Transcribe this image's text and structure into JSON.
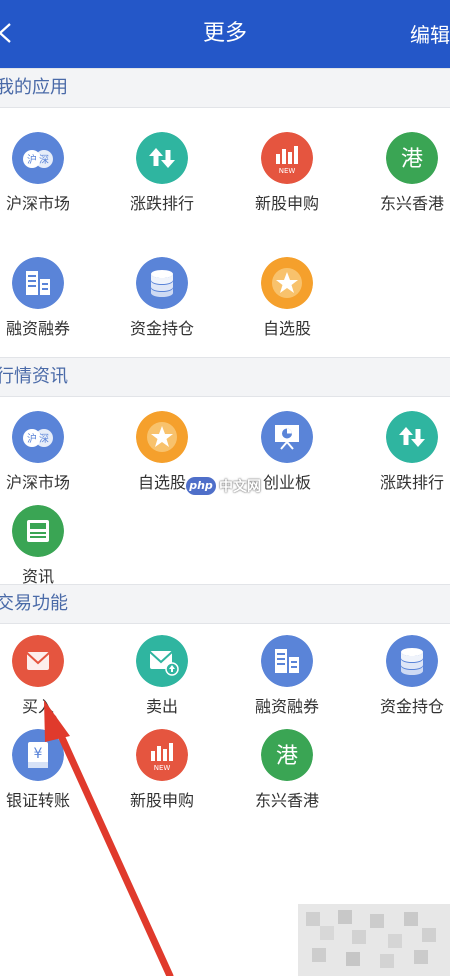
{
  "nav": {
    "title": "更多",
    "edit_label": "编辑",
    "back_icon": "chevron-left-icon",
    "bg_color": "#2457c8"
  },
  "sections": [
    {
      "title": "我的应用",
      "items": [
        {
          "label": "沪深市场",
          "icon": "hushen-market-icon"
        },
        {
          "label": "涨跌排行",
          "icon": "up-down-arrows-icon"
        },
        {
          "label": "新股申购",
          "icon": "new-stock-chart-icon"
        },
        {
          "label": "东兴香港",
          "icon": "hong-kong-icon"
        },
        {
          "label": "融资融券",
          "icon": "margin-trading-icon"
        },
        {
          "label": "资金持仓",
          "icon": "coin-stack-icon"
        },
        {
          "label": "自选股",
          "icon": "star-icon"
        }
      ]
    },
    {
      "title": "行情资讯",
      "items": [
        {
          "label": "沪深市场",
          "icon": "hushen-market-icon"
        },
        {
          "label": "自选股",
          "icon": "star-icon"
        },
        {
          "label": "创业板",
          "icon": "presentation-board-icon"
        },
        {
          "label": "涨跌排行",
          "icon": "up-down-arrows-icon"
        },
        {
          "label": "资讯",
          "icon": "newspaper-icon"
        }
      ]
    },
    {
      "title": "交易功能",
      "items": [
        {
          "label": "买入",
          "icon": "envelope-icon"
        },
        {
          "label": "卖出",
          "icon": "envelope-arrow-icon"
        },
        {
          "label": "融资融券",
          "icon": "margin-trading-icon"
        },
        {
          "label": "资金持仓",
          "icon": "coin-stack-icon"
        },
        {
          "label": "银证转账",
          "icon": "bank-book-icon"
        },
        {
          "label": "新股申购",
          "icon": "new-stock-chart-icon"
        },
        {
          "label": "东兴香港",
          "icon": "hong-kong-icon"
        }
      ]
    }
  ],
  "watermark": {
    "logo": "php",
    "text": "中文网"
  },
  "icon_text": {
    "new": "NEW",
    "hk": "港",
    "yen": "¥"
  },
  "colors": {
    "blue": "#5a84d8",
    "teal": "#2fb5a0",
    "red": "#e5553f",
    "green": "#3aa554",
    "orange": "#f5a02c",
    "annotation_arrow": "#e03a2c"
  }
}
